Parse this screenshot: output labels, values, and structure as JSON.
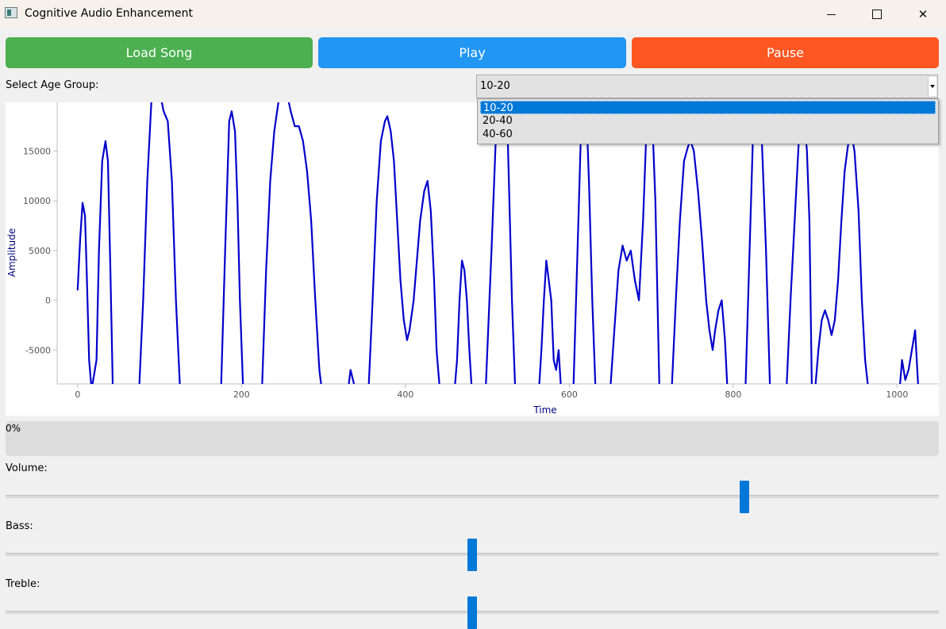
{
  "window": {
    "title": "Cognitive Audio Enhancement"
  },
  "buttons": {
    "load": "Load Song",
    "play": "Play",
    "pause": "Pause"
  },
  "age_group": {
    "label": "Select Age Group:",
    "selected": "10-20",
    "options": [
      "10-20",
      "20-40",
      "40-60"
    ]
  },
  "chart_data": {
    "type": "line",
    "xlabel": "Time",
    "ylabel": "Amplitude",
    "xlim": [
      -25,
      1050
    ],
    "ylim": [
      -8400,
      19900
    ],
    "x_ticks": [
      0,
      200,
      400,
      600,
      800,
      1000
    ],
    "y_ticks": [
      -5000,
      0,
      5000,
      10000,
      15000
    ],
    "x_tick_labels": [
      "0",
      "200",
      "400",
      "600",
      "800",
      "1000"
    ],
    "y_tick_labels": [
      "-5000",
      "0",
      "5000",
      "10000",
      "15000"
    ],
    "series_color": "#0000cc",
    "points": [
      [
        0,
        1000
      ],
      [
        3,
        6000
      ],
      [
        6,
        9800
      ],
      [
        9,
        8500
      ],
      [
        11,
        3000
      ],
      [
        14,
        -6000
      ],
      [
        17,
        -9000
      ],
      [
        23,
        -6000
      ],
      [
        26,
        5000
      ],
      [
        30,
        14000
      ],
      [
        34,
        16000
      ],
      [
        37,
        14000
      ],
      [
        40,
        3000
      ],
      [
        43,
        -9000
      ],
      [
        75,
        -9000
      ],
      [
        80,
        0
      ],
      [
        85,
        12000
      ],
      [
        90,
        19900
      ],
      [
        95,
        21000
      ],
      [
        100,
        21000
      ],
      [
        105,
        19000
      ],
      [
        110,
        18000
      ],
      [
        115,
        12000
      ],
      [
        120,
        0
      ],
      [
        125,
        -9000
      ],
      [
        175,
        -9000
      ],
      [
        180,
        5000
      ],
      [
        185,
        18000
      ],
      [
        188,
        19000
      ],
      [
        192,
        17000
      ],
      [
        195,
        10000
      ],
      [
        198,
        0
      ],
      [
        202,
        -9000
      ],
      [
        225,
        -9000
      ],
      [
        230,
        3000
      ],
      [
        235,
        12000
      ],
      [
        240,
        17000
      ],
      [
        245,
        19900
      ],
      [
        250,
        21000
      ],
      [
        255,
        21000
      ],
      [
        260,
        19000
      ],
      [
        265,
        17500
      ],
      [
        270,
        17500
      ],
      [
        275,
        16000
      ],
      [
        280,
        13000
      ],
      [
        285,
        8000
      ],
      [
        290,
        0
      ],
      [
        295,
        -7000
      ],
      [
        298,
        -9000
      ],
      [
        330,
        -9000
      ],
      [
        333,
        -7000
      ],
      [
        336,
        -8000
      ],
      [
        339,
        -9000
      ],
      [
        355,
        -9000
      ],
      [
        360,
        0
      ],
      [
        365,
        10000
      ],
      [
        370,
        16000
      ],
      [
        375,
        18000
      ],
      [
        378,
        18500
      ],
      [
        382,
        17000
      ],
      [
        386,
        14000
      ],
      [
        390,
        8000
      ],
      [
        394,
        2000
      ],
      [
        398,
        -2000
      ],
      [
        402,
        -4000
      ],
      [
        405,
        -3000
      ],
      [
        410,
        0
      ],
      [
        414,
        4000
      ],
      [
        418,
        8000
      ],
      [
        423,
        11000
      ],
      [
        427,
        12000
      ],
      [
        431,
        9000
      ],
      [
        435,
        2000
      ],
      [
        438,
        -5000
      ],
      [
        442,
        -9000
      ],
      [
        460,
        -9000
      ],
      [
        463,
        -6000
      ],
      [
        466,
        0
      ],
      [
        469,
        4000
      ],
      [
        472,
        3000
      ],
      [
        475,
        0
      ],
      [
        478,
        -5000
      ],
      [
        481,
        -9000
      ],
      [
        498,
        -9000
      ],
      [
        505,
        5000
      ],
      [
        512,
        19900
      ],
      [
        518,
        21000
      ],
      [
        525,
        16000
      ],
      [
        530,
        0
      ],
      [
        534,
        -9000
      ],
      [
        563,
        -9000
      ],
      [
        566,
        -5000
      ],
      [
        569,
        0
      ],
      [
        572,
        4000
      ],
      [
        575,
        2000
      ],
      [
        578,
        0
      ],
      [
        581,
        -6000
      ],
      [
        584,
        -7000
      ],
      [
        587,
        -5000
      ],
      [
        590,
        -9000
      ],
      [
        605,
        -9000
      ],
      [
        610,
        5000
      ],
      [
        615,
        19000
      ],
      [
        620,
        21000
      ],
      [
        624,
        12000
      ],
      [
        628,
        0
      ],
      [
        632,
        -9000
      ],
      [
        650,
        -9000
      ],
      [
        655,
        -3000
      ],
      [
        660,
        3000
      ],
      [
        665,
        5500
      ],
      [
        670,
        4000
      ],
      [
        675,
        5000
      ],
      [
        680,
        2000
      ],
      [
        685,
        0
      ],
      [
        690,
        8000
      ],
      [
        695,
        19000
      ],
      [
        700,
        21000
      ],
      [
        705,
        10000
      ],
      [
        710,
        -9000
      ],
      [
        725,
        -9000
      ],
      [
        730,
        0
      ],
      [
        735,
        8000
      ],
      [
        740,
        14000
      ],
      [
        745,
        15500
      ],
      [
        748,
        16000
      ],
      [
        752,
        15000
      ],
      [
        757,
        11000
      ],
      [
        762,
        6000
      ],
      [
        767,
        0
      ],
      [
        771,
        -3000
      ],
      [
        775,
        -5000
      ],
      [
        778,
        -3000
      ],
      [
        782,
        -1000
      ],
      [
        786,
        0
      ],
      [
        790,
        -4000
      ],
      [
        793,
        -9000
      ],
      [
        800,
        -9000
      ],
      [
        815,
        -9000
      ],
      [
        820,
        5000
      ],
      [
        825,
        19000
      ],
      [
        830,
        21000
      ],
      [
        835,
        16000
      ],
      [
        840,
        5000
      ],
      [
        845,
        -9000
      ],
      [
        865,
        -9000
      ],
      [
        870,
        0
      ],
      [
        875,
        8000
      ],
      [
        880,
        16000
      ],
      [
        885,
        19900
      ],
      [
        890,
        15000
      ],
      [
        893,
        8000
      ],
      [
        896,
        -9000
      ],
      [
        900,
        -9000
      ],
      [
        904,
        -5000
      ],
      [
        908,
        -2000
      ],
      [
        912,
        -1000
      ],
      [
        916,
        -2000
      ],
      [
        920,
        -3500
      ],
      [
        924,
        -2000
      ],
      [
        928,
        2000
      ],
      [
        932,
        8000
      ],
      [
        936,
        13000
      ],
      [
        940,
        15500
      ],
      [
        944,
        17000
      ],
      [
        948,
        15000
      ],
      [
        953,
        9000
      ],
      [
        957,
        0
      ],
      [
        961,
        -6000
      ],
      [
        965,
        -9000
      ],
      [
        1003,
        -9000
      ],
      [
        1006,
        -6000
      ],
      [
        1010,
        -8000
      ],
      [
        1014,
        -7000
      ],
      [
        1018,
        -5000
      ],
      [
        1022,
        -3000
      ],
      [
        1026,
        -9000
      ]
    ]
  },
  "progress": {
    "text": "0%",
    "value": 0
  },
  "sliders": [
    {
      "label": "Volume:",
      "value": 0.795
    },
    {
      "label": "Bass:",
      "value": 0.5
    },
    {
      "label": "Treble:",
      "value": 0.5
    }
  ]
}
